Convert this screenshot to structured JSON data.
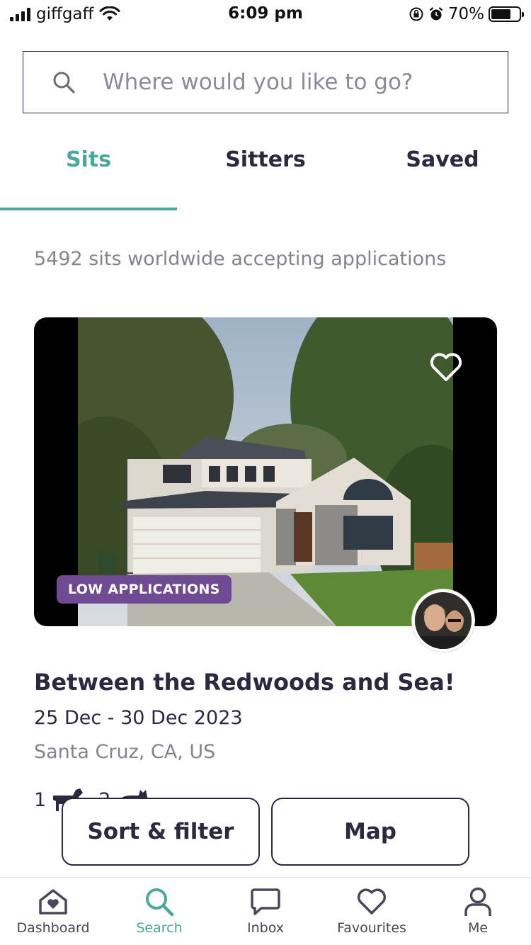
{
  "status_bar": {
    "carrier": "giffgaff",
    "time": "6:09 pm",
    "battery_percent": "70%",
    "battery_level": 0.7
  },
  "search": {
    "placeholder": "Where would you like to go?"
  },
  "tabs": [
    {
      "label": "Sits",
      "active": true
    },
    {
      "label": "Sitters",
      "active": false
    },
    {
      "label": "Saved",
      "active": false
    }
  ],
  "results_count_text": "5492 sits worldwide accepting applications",
  "listing": {
    "badge": "LOW APPLICATIONS",
    "title": "Between the Redwoods and Sea!",
    "dates": "25 Dec - 30 Dec 2023",
    "location": "Santa Cruz, CA, US",
    "pets": [
      {
        "count": "1",
        "icon": "dog-icon"
      },
      {
        "count": "2",
        "icon": "cat-icon"
      }
    ],
    "favourited": false
  },
  "buttons": {
    "sort_filter": "Sort & filter",
    "map": "Map"
  },
  "bottom_nav": [
    {
      "label": "Dashboard",
      "icon": "home-heart-icon"
    },
    {
      "label": "Search",
      "icon": "search-icon",
      "active": true
    },
    {
      "label": "Inbox",
      "icon": "chat-icon"
    },
    {
      "label": "Favourites",
      "icon": "heart-icon"
    },
    {
      "label": "Me",
      "icon": "person-icon"
    }
  ],
  "colors": {
    "accent": "#4aa99a",
    "text_dark": "#2b2840",
    "badge_bg": "#6e4a92"
  }
}
